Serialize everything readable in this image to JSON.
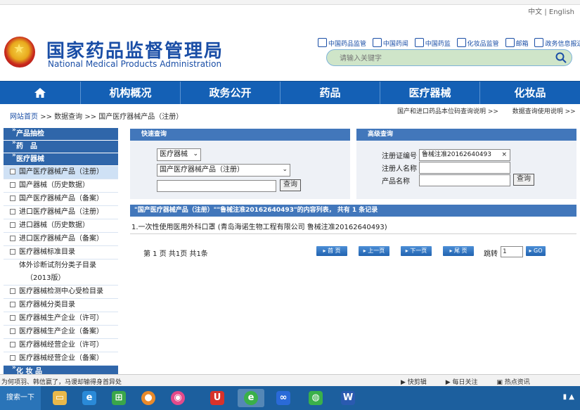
{
  "lang": {
    "zh": "中文",
    "sep": "|",
    "en": "English"
  },
  "header": {
    "title_cn": "国家药品监督管理局",
    "title_en": "National Medical Products Administration",
    "quicklinks": [
      "中国药品监管",
      "中国药闻",
      "中国药监",
      "化妆品监管",
      "邮箱",
      "政务信息报送"
    ],
    "search_placeholder": "请输入关键字"
  },
  "nav": [
    "机构概况",
    "政务公开",
    "药品",
    "医疗器械",
    "化妆品"
  ],
  "breadcrumb": {
    "home": "网站首页",
    "sep1": ">>",
    "mid": "数据查询",
    "sep2": ">>",
    "current": "国产医疗器械产品（注册）"
  },
  "rightlinks": {
    "a": "国产和进口药品本位码查询说明 >>",
    "b": "数据查询使用说明 >>"
  },
  "sidebar": {
    "head1": "产品抽检",
    "head2": "药　品",
    "head3": "医疗器械",
    "items": [
      "国产医疗器械产品（注册）",
      "国产器械（历史数据）",
      "国产医疗器械产品（备案）",
      "进口医疗器械产品（注册）",
      "进口器械（历史数据）",
      "进口医疗器械产品（备案）",
      "医疗器械标准目录",
      "体外诊断试剂分类子目录",
      "（2013版）",
      "医疗器械检测中心受检目录",
      "医疗器械分类目录",
      "医疗器械生产企业（许可）",
      "医疗器械生产企业（备案）",
      "医疗器械经营企业（许可）",
      "医疗器械经营企业（备案）"
    ],
    "head4": "化 妆 品"
  },
  "quick": {
    "title": "快速查询",
    "select1": "医疗器械",
    "select2": "国产医疗器械产品（注册）",
    "input": "",
    "button": "查询"
  },
  "adv": {
    "title": "高级查询",
    "label1": "注册证编号",
    "value1": "鲁械注准20162640493",
    "clear": "×",
    "label2": "注册人名称",
    "value2": "",
    "label3": "产品名称",
    "value3": "",
    "button": "查询"
  },
  "results": {
    "header": "\"国产医疗器械产品（注册）\"\"鲁械注准20162640493\"的内容列表， 共有 1 条记录",
    "row1": "1.一次性使用医用外科口罩 (青岛海诺生物工程有限公司 鲁械注准20162640493)",
    "pageinfo": "第 1 页 共1页 共1条",
    "first": "首 页",
    "prev": "上一页",
    "next": "下一页",
    "last": "尾 页",
    "jump_label": "跳转",
    "jump_value": "1",
    "go": "GO"
  },
  "status": {
    "left": "为何项羽、韩信嬴了，马谡却输得身首异处",
    "right": [
      "快剪辑",
      "每日关注",
      "热点资讯"
    ]
  },
  "taskbar": {
    "start": "搜索一下"
  },
  "colors": {
    "brand_blue": "#1460b5",
    "panel_blue": "#4277bb",
    "title_blue": "#1a4ea6"
  }
}
